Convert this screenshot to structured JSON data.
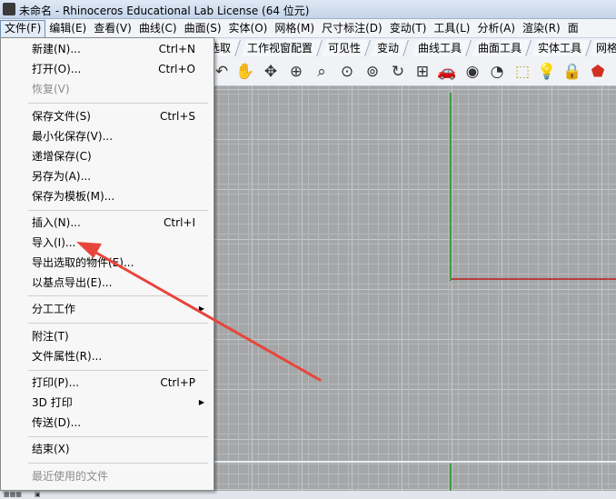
{
  "window": {
    "title": "未命名 - Rhinoceros Educational Lab License (64 位元)"
  },
  "menubar": [
    "文件(F)",
    "编辑(E)",
    "查看(V)",
    "曲线(C)",
    "曲面(S)",
    "实体(O)",
    "网格(M)",
    "尺寸标注(D)",
    "变动(T)",
    "工具(L)",
    "分析(A)",
    "渲染(R)",
    "面"
  ],
  "tabs": [
    "选取",
    "工作视窗配置",
    "可见性",
    "变动",
    "曲线工具",
    "曲面工具",
    "实体工具",
    "网格"
  ],
  "toolbar_icons": [
    "rotate-view-icon",
    "pan-hand-icon",
    "rotate-3d-icon",
    "zoom-icon",
    "zoom-window-icon",
    "zoom-extents-icon",
    "zoom-selected-icon",
    "undo-view-icon",
    "four-viewports-icon",
    "car-render-icon",
    "eye-display-icon",
    "circle-display-icon",
    "selection-icon",
    "lightbulb-icon",
    "lock-icon",
    "shield-color-icon"
  ],
  "file_menu": {
    "items": [
      {
        "label": "新建(N)...",
        "shortcut": "Ctrl+N"
      },
      {
        "label": "打开(O)...",
        "shortcut": "Ctrl+O"
      },
      {
        "label": "恢复(V)",
        "shortcut": "",
        "disabled": true
      },
      {
        "label": "保存文件(S)",
        "shortcut": "Ctrl+S"
      },
      {
        "label": "最小化保存(V)...",
        "shortcut": ""
      },
      {
        "label": "递增保存(C)",
        "shortcut": ""
      },
      {
        "label": "另存为(A)...",
        "shortcut": ""
      },
      {
        "label": "保存为模板(M)...",
        "shortcut": ""
      },
      {
        "label": "插入(N)...",
        "shortcut": "Ctrl+I"
      },
      {
        "label": "导入(I)...",
        "shortcut": ""
      },
      {
        "label": "导出选取的物件(E)...",
        "shortcut": ""
      },
      {
        "label": "以基点导出(E)...",
        "shortcut": ""
      },
      {
        "label": "分工工作",
        "shortcut": "",
        "submenu": true
      },
      {
        "label": "附注(T)",
        "shortcut": ""
      },
      {
        "label": "文件属性(R)...",
        "shortcut": ""
      },
      {
        "label": "打印(P)...",
        "shortcut": "Ctrl+P"
      },
      {
        "label": "3D 打印",
        "shortcut": "",
        "submenu": true
      },
      {
        "label": "传送(D)...",
        "shortcut": ""
      },
      {
        "label": "结束(X)",
        "shortcut": ""
      },
      {
        "label": "最近使用的文件",
        "shortcut": "",
        "disabled": true
      }
    ]
  },
  "colors": {
    "axis_x": "#b44040",
    "axis_y": "#3f9a3f",
    "annotation_arrow": "#e8453c"
  }
}
